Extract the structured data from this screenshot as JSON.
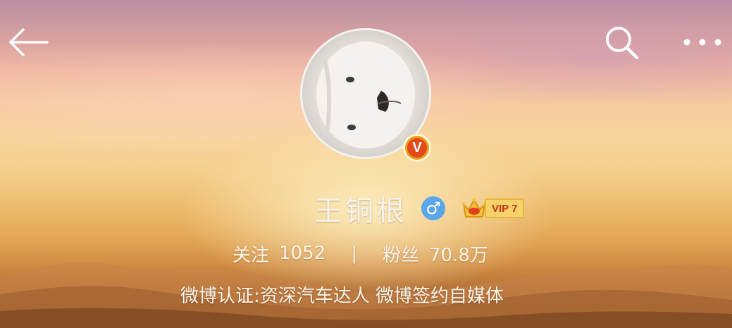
{
  "profile": {
    "name": "王铜根",
    "gender_symbol": "♂",
    "verified_mark": "V",
    "vip_label": "VIP 7",
    "stats": {
      "following_label": "关注",
      "following_value": "1052",
      "separator": "|",
      "followers_label": "粉丝",
      "followers_value": "70.8万"
    },
    "certification": "微博认证:资深汽车达人 微博签约自媒体"
  },
  "icons": {
    "back": "back-arrow-icon",
    "search": "search-icon",
    "more": "more-icon",
    "gender": "male-icon",
    "vip": "crown-icon"
  },
  "colors": {
    "gender_badge": "#5aa8ea",
    "verified_badge": "#e24a1c",
    "vip_badge": "#f6d36a"
  }
}
